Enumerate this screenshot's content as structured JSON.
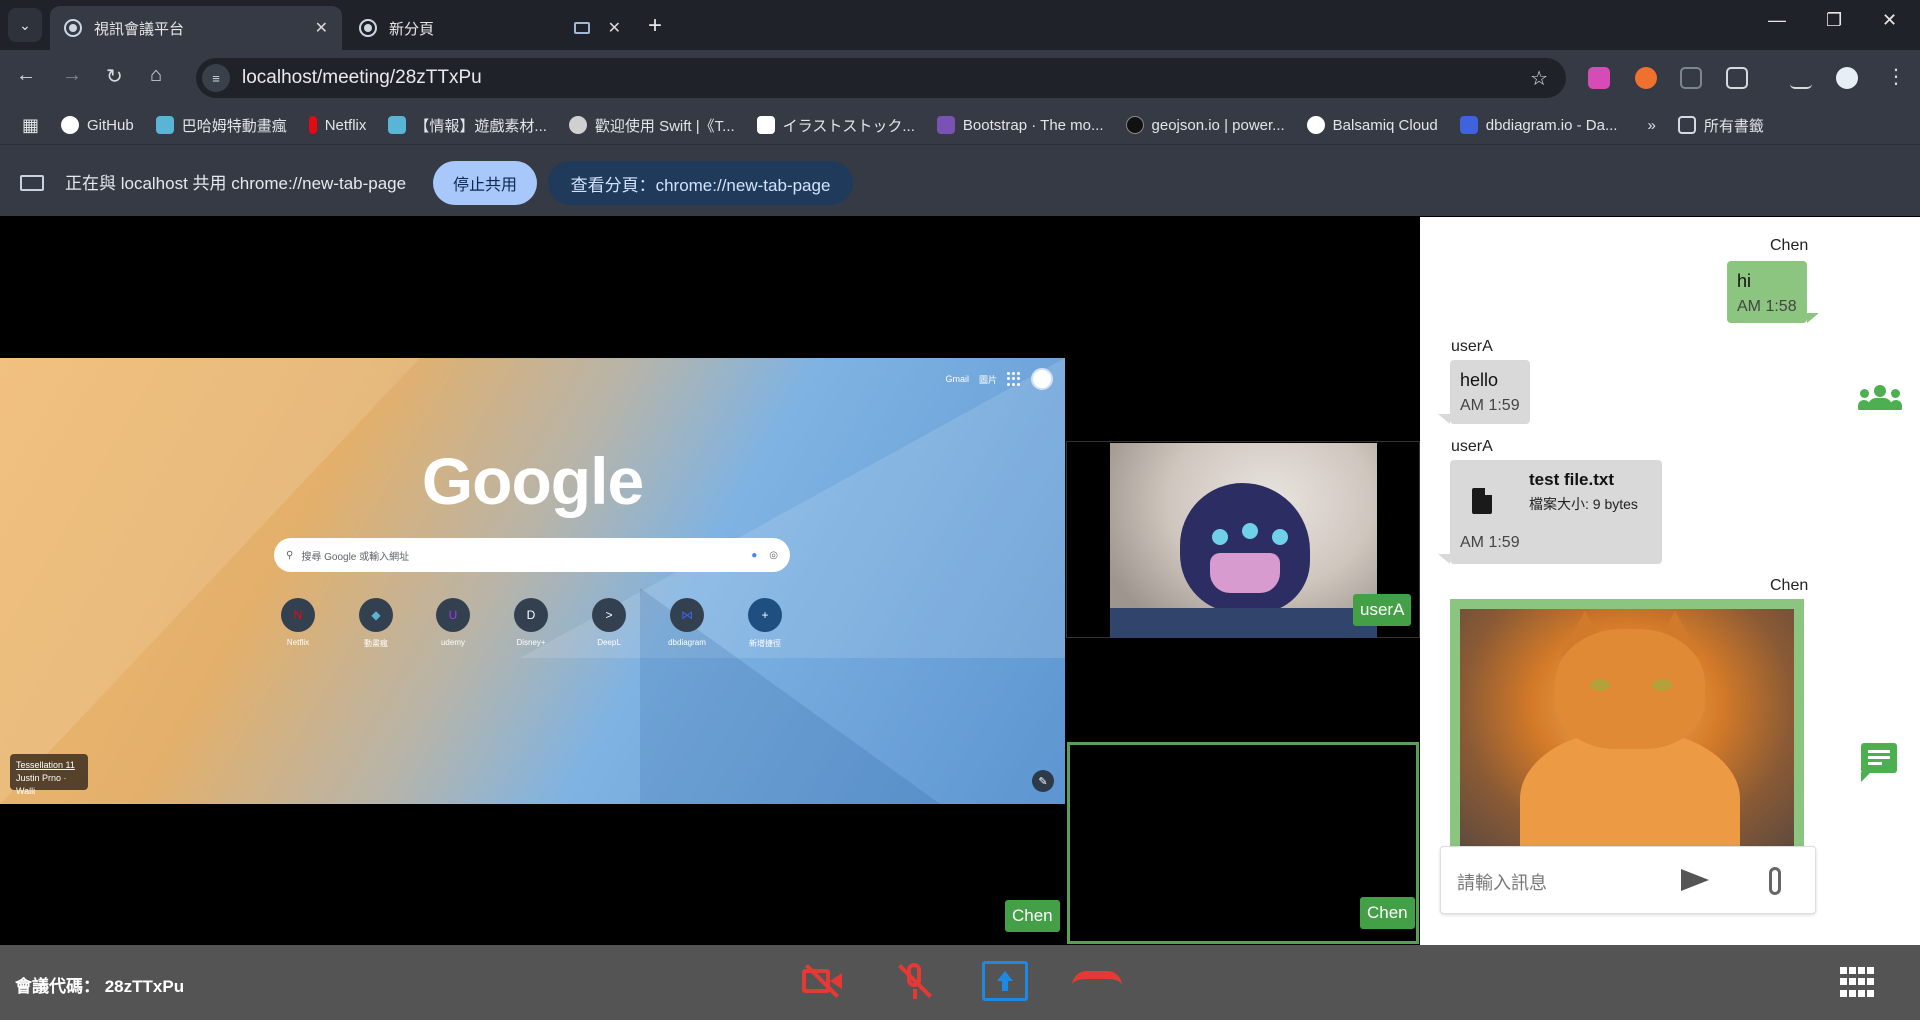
{
  "browser": {
    "tabs": [
      {
        "title": "視訊會議平台",
        "active": true
      },
      {
        "title": "新分頁",
        "active": false
      }
    ],
    "address": "localhost/meeting/28zTTxPu",
    "bookmarks": [
      {
        "label": "GitHub",
        "color": "#ffffff"
      },
      {
        "label": "巴哈姆特動畫瘋",
        "color": "#5ab4d6"
      },
      {
        "label": "Netflix",
        "color": "#e50914"
      },
      {
        "label": "【情報】遊戲素材...",
        "color": "#5ab4d6"
      },
      {
        "label": "歡迎使用 Swift |《T...",
        "color": "#d0d0d0"
      },
      {
        "label": "イラストストック...",
        "color": "#ffffff"
      },
      {
        "label": "Bootstrap · The mo...",
        "color": "#7952b3"
      },
      {
        "label": "geojson.io | power...",
        "color": "#222222"
      },
      {
        "label": "Balsamiq Cloud",
        "color": "#ffffff"
      },
      {
        "label": "dbdiagram.io - Da...",
        "color": "#3e63dd"
      }
    ],
    "bookmarks_overflow": "»",
    "all_bookmarks": "所有書籤"
  },
  "sharebar": {
    "text": "正在與 localhost 共用 chrome://new-tab-page",
    "stop_label": "停止共用",
    "view_label": "查看分頁：chrome://new-tab-page"
  },
  "shared_screen": {
    "gmail": "Gmail",
    "images": "圖片",
    "logo": "Google",
    "search_placeholder": "搜尋 Google 或輸入網址",
    "shortcuts": [
      "Netflix",
      "動畫瘋",
      "udemy",
      "Disney+",
      "DeepL",
      "dbdiagram",
      "新增捷徑"
    ],
    "credit_line1": "Tessellation 11",
    "credit_line2": "Justin Prno · Walli"
  },
  "participants": {
    "main_tag": "Chen",
    "userA_tag": "userA",
    "self_tag": "Chen"
  },
  "chat": {
    "messages": [
      {
        "sender": "Chen",
        "text": "hi",
        "time": "AM 1:58"
      },
      {
        "sender": "userA",
        "text": "hello",
        "time": "AM 1:59"
      },
      {
        "sender": "userA",
        "file_name": "test file.txt",
        "file_size": "檔案大小: 9 bytes",
        "time": "AM 1:59"
      },
      {
        "sender": "Chen",
        "image": "cat-photo"
      }
    ],
    "input_placeholder": "請輸入訊息"
  },
  "toolbar": {
    "meeting_code": "會議代碼： 28zTTxPu"
  },
  "colors": {
    "accent_green": "#4caf50",
    "danger_red": "#e53935",
    "share_blue": "#1e88e5"
  }
}
